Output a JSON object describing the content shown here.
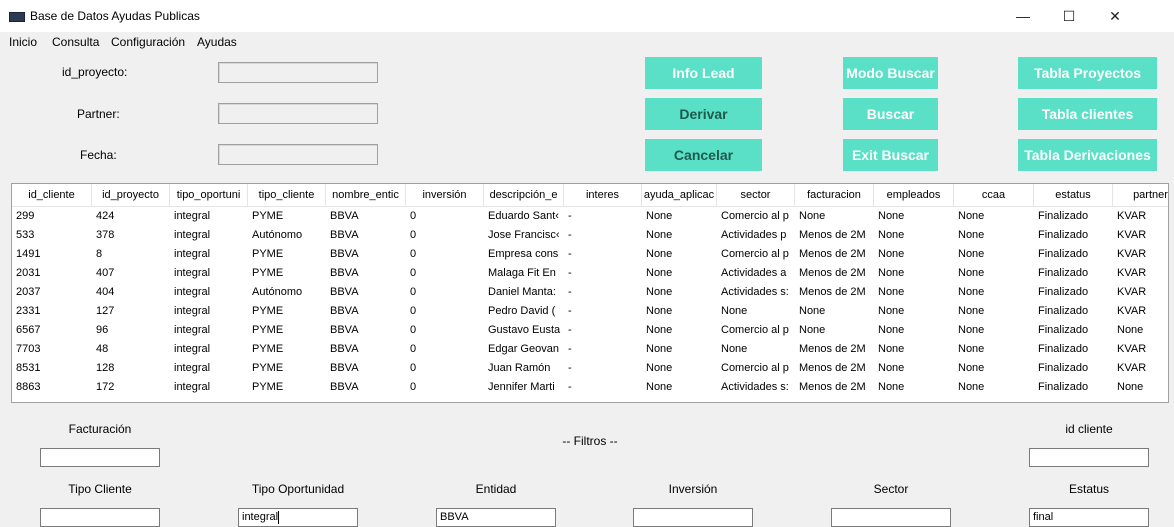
{
  "window": {
    "title": "Base de Datos Ayudas Publicas",
    "controls": {
      "minimize": "—",
      "maximize": "☐",
      "close": "✕"
    }
  },
  "menu": [
    "Inicio",
    "Consulta",
    "Configuración",
    "Ayudas"
  ],
  "form": {
    "id_proyecto_label": "id_proyecto:",
    "partner_label": "Partner:",
    "fecha_label": "Fecha:",
    "id_proyecto_value": "",
    "partner_value": "",
    "fecha_value": ""
  },
  "buttons": {
    "info_lead": "Info Lead",
    "derivar": "Derivar",
    "cancelar": "Cancelar",
    "modo_buscar": "Modo Buscar",
    "buscar": "Buscar",
    "exit_buscar": "Exit Buscar",
    "tabla_proyectos": "Tabla Proyectos",
    "tabla_clientes": "Tabla clientes",
    "tabla_derivaciones": "Tabla Derivaciones"
  },
  "colors": {
    "button_bg": "#59e0c6",
    "button_text": "#ffffff",
    "button_active_text": "#1f5a4f"
  },
  "table": {
    "columns": [
      "id_cliente",
      "id_proyecto",
      "tipo_oportuni",
      "tipo_cliente",
      "nombre_entic",
      "inversión",
      "descripción_e",
      "interes",
      "ayuda_aplicac",
      "sector",
      "facturacion",
      "empleados",
      "ccaa",
      "estatus",
      "partner"
    ],
    "rows": [
      [
        "299",
        "424",
        "integral",
        "PYME",
        "BBVA",
        "0",
        "Eduardo Sant‹",
        "-",
        "None",
        "Comercio al p",
        "None",
        "None",
        "None",
        "Finalizado",
        "KVAR"
      ],
      [
        "533",
        "378",
        "integral",
        "Autónomo",
        "BBVA",
        "0",
        "Jose Francisc‹",
        "-",
        "None",
        "Actividades p",
        "Menos de 2M",
        "None",
        "None",
        "Finalizado",
        "KVAR"
      ],
      [
        "1491",
        "8",
        "integral",
        "PYME",
        "BBVA",
        "0",
        "Empresa cons",
        "-",
        "None",
        "Comercio al p",
        "Menos de 2M",
        "None",
        "None",
        "Finalizado",
        "KVAR"
      ],
      [
        "2031",
        "407",
        "integral",
        "PYME",
        "BBVA",
        "0",
        "Malaga Fit En",
        "-",
        "None",
        "Actividades a",
        "Menos de 2M",
        "None",
        "None",
        "Finalizado",
        "KVAR"
      ],
      [
        "2037",
        "404",
        "integral",
        "Autónomo",
        "BBVA",
        "0",
        "Daniel Manta:",
        "-",
        "None",
        "Actividades s:",
        "Menos de 2M",
        "None",
        "None",
        "Finalizado",
        "KVAR"
      ],
      [
        "2331",
        "127",
        "integral",
        "PYME",
        "BBVA",
        "0",
        "Pedro David (",
        "-",
        "None",
        "None",
        "None",
        "None",
        "None",
        "Finalizado",
        "KVAR"
      ],
      [
        "6567",
        "96",
        "integral",
        "PYME",
        "BBVA",
        "0",
        "Gustavo Eusta",
        "-",
        "None",
        "Comercio al p",
        "None",
        "None",
        "None",
        "Finalizado",
        "None"
      ],
      [
        "7703",
        "48",
        "integral",
        "PYME",
        "BBVA",
        "0",
        "Edgar Geovan",
        "-",
        "None",
        "None",
        "Menos de 2M",
        "None",
        "None",
        "Finalizado",
        "KVAR"
      ],
      [
        "8531",
        "128",
        "integral",
        "PYME",
        "BBVA",
        "0",
        "Juan Ramón",
        "-",
        "None",
        "Comercio al p",
        "Menos de 2M",
        "None",
        "None",
        "Finalizado",
        "KVAR"
      ],
      [
        "8863",
        "172",
        "integral",
        "PYME",
        "BBVA",
        "0",
        "Jennifer Marti",
        "-",
        "None",
        "Actividades s:",
        "Menos de 2M",
        "None",
        "None",
        "Finalizado",
        "None"
      ]
    ]
  },
  "filters": {
    "title": "-- Filtros --",
    "facturacion_label": "Facturación",
    "id_cliente_label": "id cliente",
    "tipo_cliente_label": "Tipo Cliente",
    "tipo_oportunidad_label": "Tipo Oportunidad",
    "entidad_label": "Entidad",
    "inversion_label": "Inversión",
    "sector_label": "Sector",
    "estatus_label": "Estatus",
    "facturacion_value": "",
    "id_cliente_value": "",
    "tipo_cliente_value": "",
    "tipo_oportunidad_value": "integral",
    "entidad_value": "BBVA",
    "inversion_value": "",
    "sector_value": "",
    "estatus_value": "final"
  }
}
